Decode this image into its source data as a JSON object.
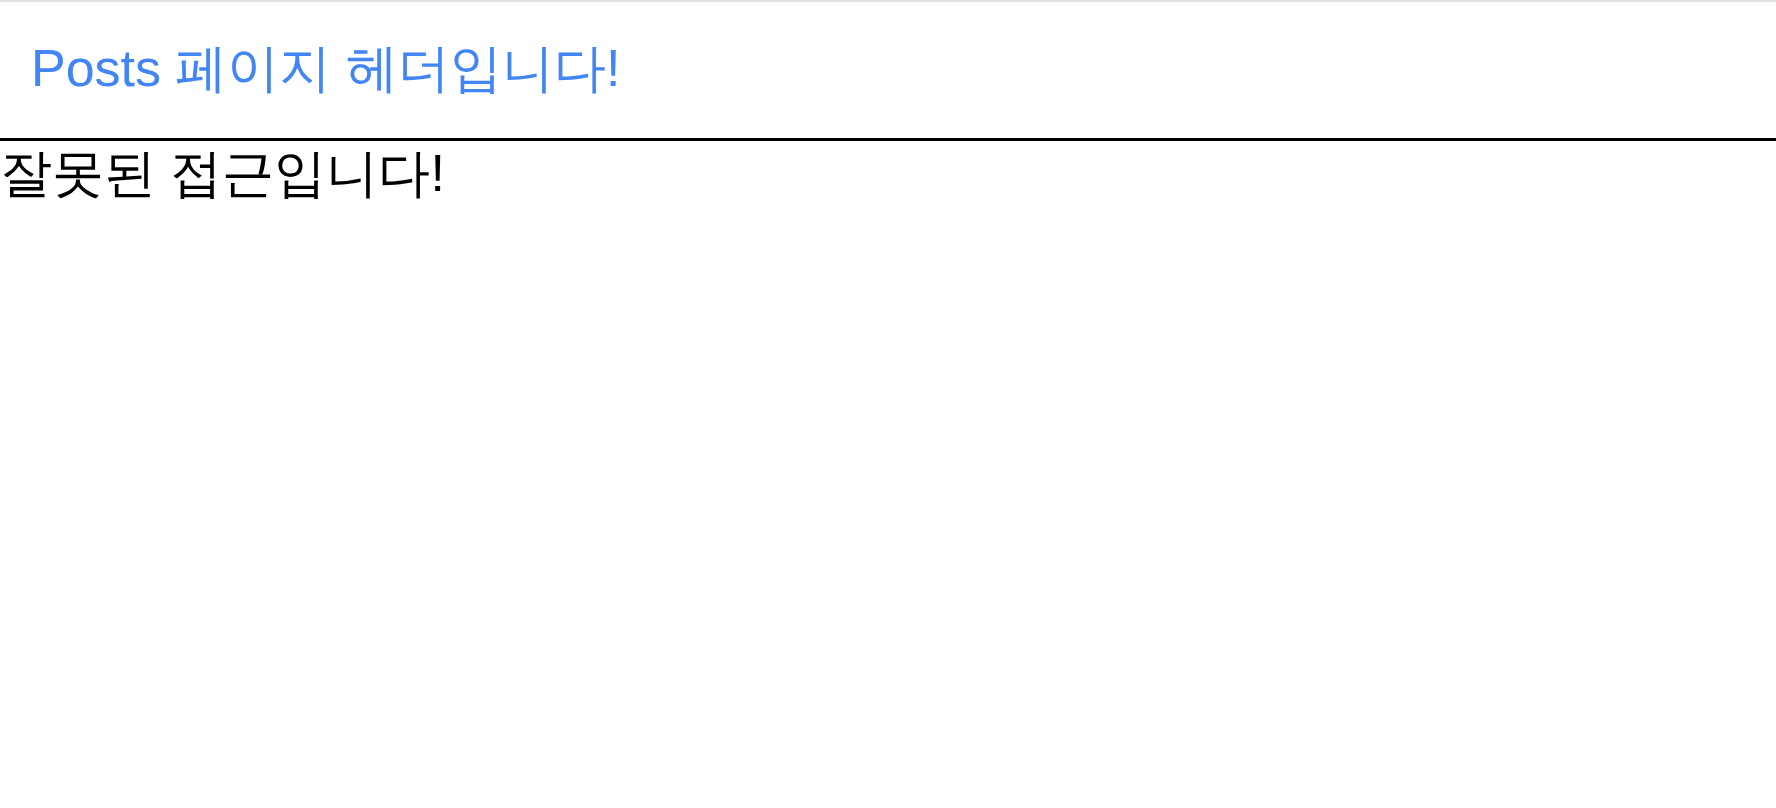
{
  "header": {
    "title": "Posts 페이지 헤더입니다!"
  },
  "message": "잘못된 접근입니다!"
}
